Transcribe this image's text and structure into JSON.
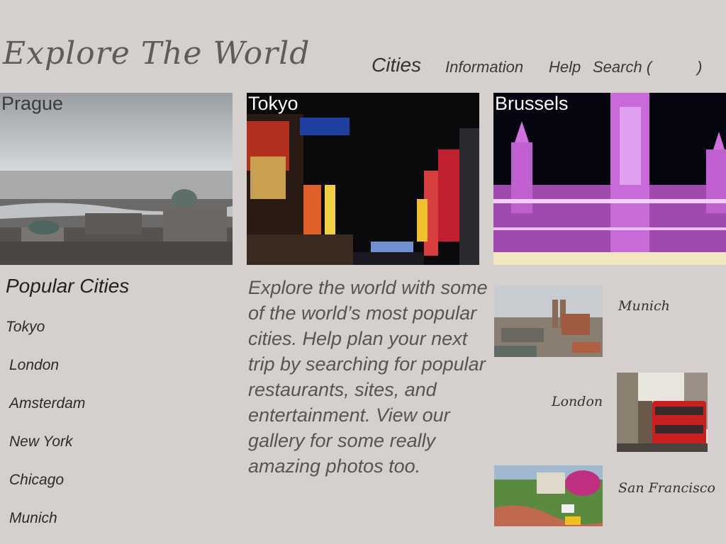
{
  "header": {
    "title": "Explore The World",
    "nav": {
      "cities": "Cities",
      "information": "Information",
      "help": "Help",
      "search_open": "Search (",
      "search_close": ")",
      "search_placeholder": ""
    }
  },
  "heroes": [
    {
      "label": "Prague"
    },
    {
      "label": "Tokyo"
    },
    {
      "label": "Brussels"
    }
  ],
  "popular": {
    "heading": "Popular Cities",
    "items": [
      "Tokyo",
      "London",
      "Amsterdam",
      "New York",
      "Chicago",
      "Munich"
    ]
  },
  "description": " Explore the world with some of the world’s most popular cities. Help plan your next trip by searching for popular restaurants, sites, and entertainment. View our gallery for some really amazing photos too.",
  "thumbnails": [
    {
      "label": "Munich"
    },
    {
      "label": "London"
    },
    {
      "label": "San Francisco"
    }
  ]
}
